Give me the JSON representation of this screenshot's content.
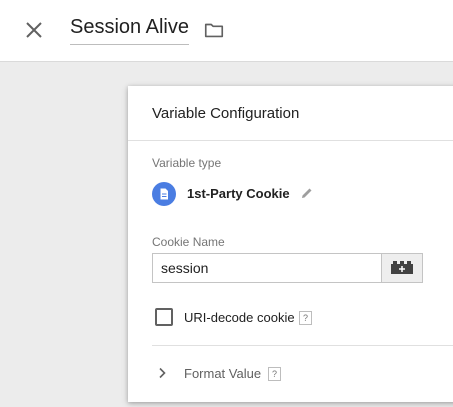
{
  "header": {
    "title": "Session Alive",
    "close_icon": "close-icon",
    "folder_icon": "folder-icon"
  },
  "card": {
    "title": "Variable Configuration",
    "variable_type_label": "Variable type",
    "variable_type": "1st-Party Cookie",
    "variable_type_icon": "document-icon",
    "edit_icon": "pencil-icon",
    "cookie_name_label": "Cookie Name",
    "cookie_name_value": "session",
    "variable_picker_icon": "add-variable-icon",
    "uri_decode_label": "URI-decode cookie",
    "uri_decode_checked": false,
    "help_glyph": "?",
    "format_value_label": "Format Value"
  },
  "colors": {
    "background": "#ececec",
    "accent": "#4a7de2",
    "card": "#ffffff"
  }
}
